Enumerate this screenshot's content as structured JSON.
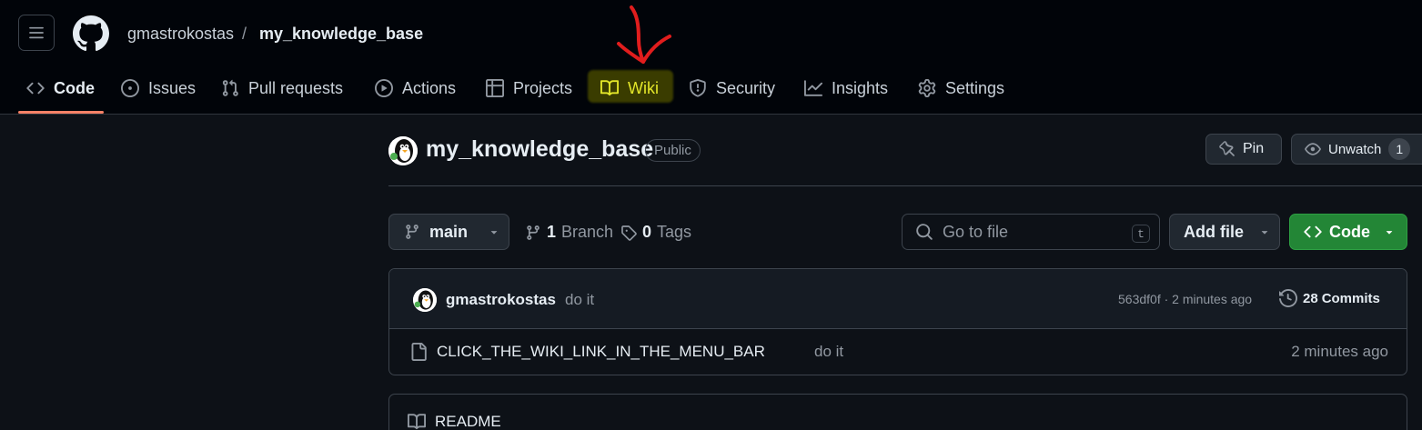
{
  "header": {
    "owner": "gmastrokostas",
    "separator": "/",
    "repo": "my_knowledge_base"
  },
  "nav": {
    "items": [
      {
        "label": "Code",
        "icon": "code-icon",
        "active": true
      },
      {
        "label": "Issues",
        "icon": "issue-icon"
      },
      {
        "label": "Pull requests",
        "icon": "pull-request-icon"
      },
      {
        "label": "Actions",
        "icon": "play-icon"
      },
      {
        "label": "Projects",
        "icon": "table-icon"
      },
      {
        "label": "Wiki",
        "icon": "book-icon",
        "highlighted": true
      },
      {
        "label": "Security",
        "icon": "shield-icon"
      },
      {
        "label": "Insights",
        "icon": "graph-icon"
      },
      {
        "label": "Settings",
        "icon": "gear-icon"
      }
    ]
  },
  "repo": {
    "title": "my_knowledge_base",
    "visibility": "Public",
    "pin_label": "Pin",
    "unwatch_label": "Unwatch",
    "watch_count": "1"
  },
  "toolbar": {
    "branch": "main",
    "branch_count": "1",
    "branch_label": "Branch",
    "tag_count": "0",
    "tag_label": "Tags",
    "search_placeholder": "Go to file",
    "search_shortcut": "t",
    "add_file_label": "Add file",
    "code_label": "Code"
  },
  "commit": {
    "author": "gmastrokostas",
    "message": "do it",
    "hash_time": "563df0f · 2 minutes ago",
    "commits_count": "28",
    "commits_label": "Commits"
  },
  "files": [
    {
      "name": "CLICK_THE_WIKI_LINK_IN_THE_MENU_BAR",
      "message": "do it",
      "time": "2 minutes ago"
    }
  ],
  "readme": {
    "label": "README"
  },
  "colors": {
    "accent_underline": "#f78166",
    "code_button": "#238636",
    "wiki_highlight_text": "#e3e629",
    "annotation_arrow": "#e11d1d"
  }
}
